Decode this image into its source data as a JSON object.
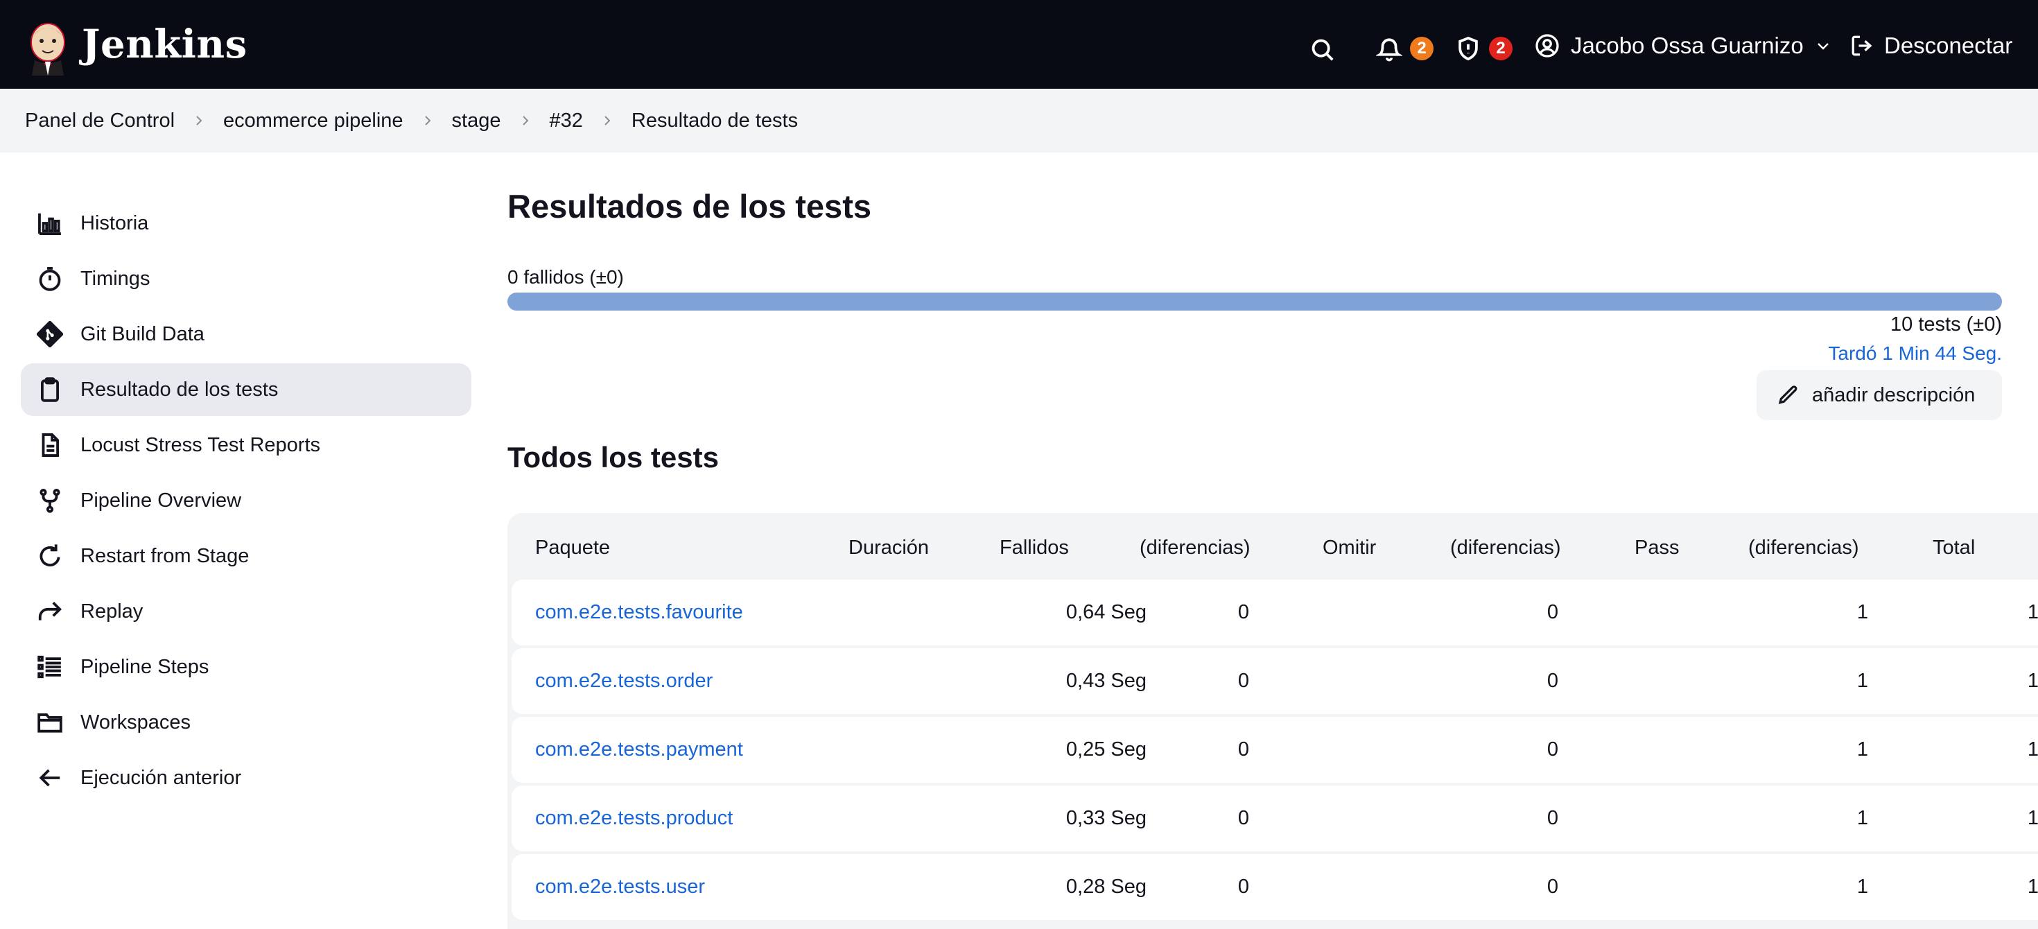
{
  "app": {
    "name": "Jenkins"
  },
  "header": {
    "notifications_count": "2",
    "security_count": "2",
    "user_name": "Jacobo Ossa Guarnizo",
    "logout_label": "Desconectar",
    "colors": {
      "notif_badge": "#f07b1d",
      "security_badge": "#e0231c",
      "bar_bg": "#080a14"
    }
  },
  "breadcrumb": [
    "Panel de Control",
    "ecommerce pipeline",
    "stage",
    "#32",
    "Resultado de tests"
  ],
  "sidebar": {
    "items": [
      {
        "label": "Historia",
        "icon": "history-chart-icon"
      },
      {
        "label": "Timings",
        "icon": "stopwatch-icon"
      },
      {
        "label": "Git Build Data",
        "icon": "git-icon"
      },
      {
        "label": "Resultado de los tests",
        "icon": "clipboard-icon",
        "active": true
      },
      {
        "label": "Locust Stress Test Reports",
        "icon": "document-icon"
      },
      {
        "label": "Pipeline Overview",
        "icon": "fork-icon"
      },
      {
        "label": "Restart from Stage",
        "icon": "restart-icon"
      },
      {
        "label": "Replay",
        "icon": "replay-icon"
      },
      {
        "label": "Pipeline Steps",
        "icon": "list-icon"
      },
      {
        "label": "Workspaces",
        "icon": "folder-icon"
      },
      {
        "label": "Ejecución anterior",
        "icon": "arrow-left-icon"
      }
    ]
  },
  "main": {
    "title": "Resultados de los tests",
    "failed_label": "0 fallidos (±0)",
    "pass_fraction": 1.0,
    "tests_count": "10 tests (±0)",
    "duration": "Tardó 1 Min 44 Seg.",
    "add_description_label": "añadir descripción",
    "all_tests_title": "Todos los tests",
    "table": {
      "headers": [
        "Paquete",
        "Duración",
        "Fallidos",
        "(diferencias)",
        "Omitir",
        "(diferencias)",
        "Pass",
        "(diferencias)",
        "Total"
      ],
      "rows": [
        {
          "package": "com.e2e.tests.favourite",
          "duration": "0,64 Seg",
          "failed": "0",
          "skipped": "0",
          "pass": "1",
          "total": "1"
        },
        {
          "package": "com.e2e.tests.order",
          "duration": "0,43 Seg",
          "failed": "0",
          "skipped": "0",
          "pass": "1",
          "total": "1"
        },
        {
          "package": "com.e2e.tests.payment",
          "duration": "0,25 Seg",
          "failed": "0",
          "skipped": "0",
          "pass": "1",
          "total": "1"
        },
        {
          "package": "com.e2e.tests.product",
          "duration": "0,33 Seg",
          "failed": "0",
          "skipped": "0",
          "pass": "1",
          "total": "1"
        },
        {
          "package": "com.e2e.tests.user",
          "duration": "0,28 Seg",
          "failed": "0",
          "skipped": "0",
          "pass": "1",
          "total": "1"
        }
      ]
    }
  }
}
